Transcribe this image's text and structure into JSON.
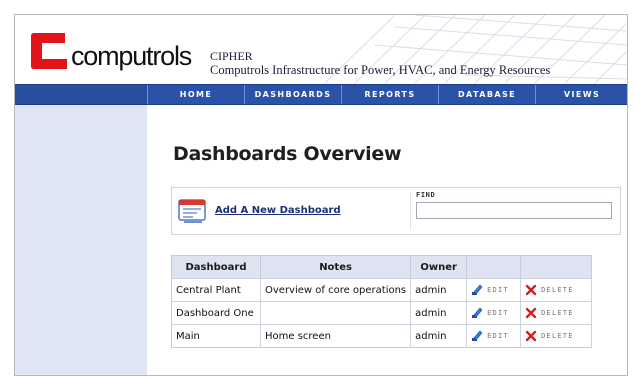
{
  "brand": {
    "wordmark": "computrols",
    "app_name": "CIPHER",
    "app_subtitle": "Computrols Infrastructure for Power, HVAC, and Energy Resources",
    "logo_color": "#e1141a"
  },
  "nav": {
    "items": [
      {
        "label": "HOME"
      },
      {
        "label": "DASHBOARDS"
      },
      {
        "label": "REPORTS"
      },
      {
        "label": "DATABASE"
      },
      {
        "label": "VIEWS"
      }
    ],
    "bar_color": "#2a53a8"
  },
  "page": {
    "title": "Dashboards Overview"
  },
  "actions": {
    "add_label": "Add A New Dashboard",
    "find_label": "FIND",
    "find_value": ""
  },
  "table": {
    "headers": [
      "Dashboard",
      "Notes",
      "Owner",
      "",
      ""
    ],
    "rows": [
      {
        "dashboard": "Central Plant",
        "notes": "Overview of core operations",
        "owner": "admin",
        "edit": "EDIT",
        "delete": "DELETE"
      },
      {
        "dashboard": "Dashboard One",
        "notes": "",
        "owner": "admin",
        "edit": "EDIT",
        "delete": "DELETE"
      },
      {
        "dashboard": "Main",
        "notes": "Home screen",
        "owner": "admin",
        "edit": "EDIT",
        "delete": "DELETE"
      }
    ]
  },
  "icons": {
    "add": "add-dashboard-icon",
    "edit": "pencil-edit-icon",
    "delete": "red-x-delete-icon"
  }
}
